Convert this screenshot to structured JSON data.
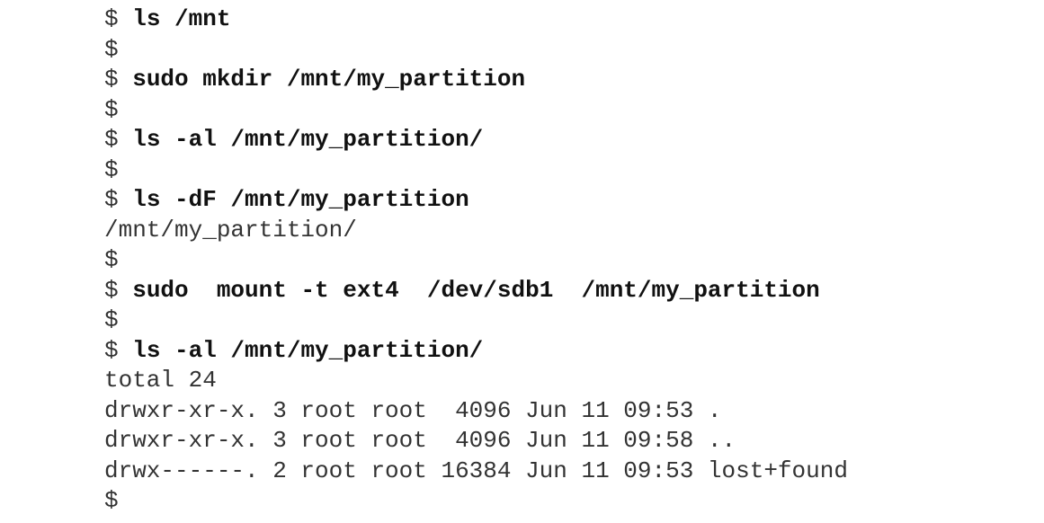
{
  "prompt": "$",
  "lines": [
    {
      "type": "command",
      "text": "ls /mnt"
    },
    {
      "type": "prompt"
    },
    {
      "type": "command",
      "text": "sudo mkdir /mnt/my_partition"
    },
    {
      "type": "prompt"
    },
    {
      "type": "command",
      "text": "ls -al /mnt/my_partition/"
    },
    {
      "type": "prompt"
    },
    {
      "type": "command",
      "text": "ls -dF /mnt/my_partition"
    },
    {
      "type": "output",
      "text": "/mnt/my_partition/"
    },
    {
      "type": "prompt"
    },
    {
      "type": "command",
      "text": "sudo  mount -t ext4  /dev/sdb1  /mnt/my_partition"
    },
    {
      "type": "prompt"
    },
    {
      "type": "command",
      "text": "ls -al /mnt/my_partition/"
    },
    {
      "type": "output",
      "text": "total 24"
    },
    {
      "type": "output",
      "text": "drwxr-xr-x. 3 root root  4096 Jun 11 09:53 ."
    },
    {
      "type": "output",
      "text": "drwxr-xr-x. 3 root root  4096 Jun 11 09:58 .."
    },
    {
      "type": "output",
      "text": "drwx------. 2 root root 16384 Jun 11 09:53 lost+found"
    },
    {
      "type": "prompt"
    }
  ]
}
